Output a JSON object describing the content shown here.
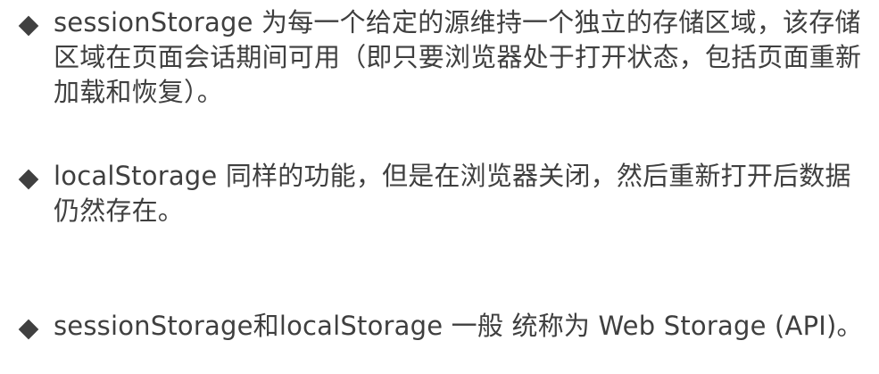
{
  "bullets": [
    {
      "text": "sessionStorage 为每一个给定的源维持一个独立的存储区域，该存储区域在页面会话期间可用（即只要浏览器处于打开状态，包括页面重新加载和恢复）。"
    },
    {
      "text": "localStorage 同样的功能，但是在浏览器关闭，然后重新打开后数据仍然存在。"
    },
    {
      "text": "sessionStorage和localStorage 一般 统称为 Web Storage (API)。"
    }
  ],
  "colors": {
    "text": "#3f3f3f",
    "bullet": "#404040",
    "background": "#ffffff"
  },
  "icons": {
    "bullet": "diamond-bullet-icon"
  }
}
